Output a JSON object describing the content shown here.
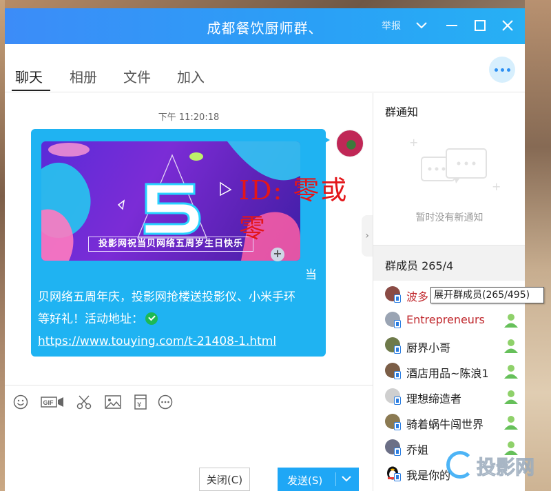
{
  "window": {
    "title": "成都餐饮厨师群、",
    "report_label": "举报"
  },
  "tabs": [
    {
      "label": "聊天",
      "active": true
    },
    {
      "label": "相册",
      "active": false
    },
    {
      "label": "文件",
      "active": false
    },
    {
      "label": "加入",
      "active": false
    }
  ],
  "chat": {
    "timestamp": "下午 11:20:18",
    "banner_caption": "投影网祝当贝网络五周岁生日快乐",
    "message_lines": [
      "当",
      "贝网络五周年庆，投影网抢楼送投影仪、小米手环",
      "等好礼！活动地址："
    ],
    "message_link": "https://www.touying.com/t-21408-1.html",
    "watermark": "ID: 零或零",
    "bubble_color": "#1fb3f2"
  },
  "toolbar": {
    "tools": [
      "smile-icon",
      "gif-icon",
      "scissors-icon",
      "image-icon",
      "red-packet-icon",
      "more-circle-icon"
    ]
  },
  "buttons": {
    "close": "关闭(C)",
    "send": "发送(S)"
  },
  "sidebar": {
    "notice_title": "群通知",
    "notice_empty": "暂时没有新通知",
    "members_title": "群成员 265/4",
    "tooltip": "展开群成员(265/495)",
    "members": [
      {
        "name": "波多",
        "red": true
      },
      {
        "name": "Entrepreneurs",
        "red": true
      },
      {
        "name": "厨界小哥",
        "red": false
      },
      {
        "name": "酒店用品~陈浪1",
        "red": false
      },
      {
        "name": "理想缔造者",
        "red": false
      },
      {
        "name": "骑着蜗牛闯世界",
        "red": false
      },
      {
        "name": "乔姐",
        "red": false
      },
      {
        "name": "我是你的",
        "red": false
      }
    ]
  },
  "site_logo": "投影网",
  "colors": {
    "titlebar": "#2aa0f6",
    "accent": "#1fa7f6",
    "member_red": "#c0282d"
  }
}
